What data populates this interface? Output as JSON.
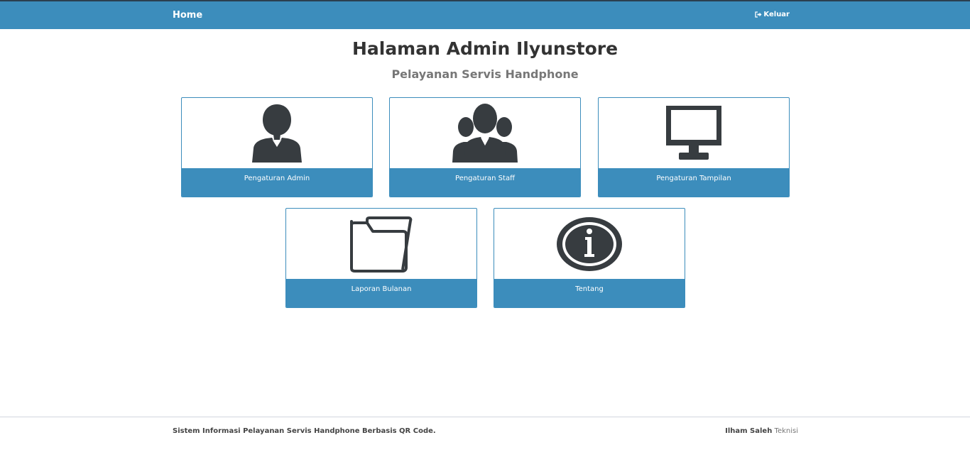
{
  "navbar": {
    "brand": "Home",
    "logout_label": "Keluar",
    "logout_icon": "sign-out-icon",
    "background": "#3c8dbc"
  },
  "header": {
    "title": "Halaman Admin Ilyunstore",
    "subtitle": "Pelayanan Servis Handphone"
  },
  "tiles": [
    {
      "label": "Pengaturan Admin",
      "icon": "user-icon"
    },
    {
      "label": "Pengaturan Staff",
      "icon": "users-group-icon"
    },
    {
      "label": "Pengaturan Tampilan",
      "icon": "monitor-icon"
    },
    {
      "label": "Laporan Bulanan",
      "icon": "folder-icon"
    },
    {
      "label": "Tentang",
      "icon": "info-icon"
    }
  ],
  "footer": {
    "left_text": "Sistem Informasi Pelayanan Servis Handphone Berbasis QR Code.",
    "author": "Ilham Saleh",
    "role": "Teknisi"
  },
  "colors": {
    "accent": "#3c8dbc",
    "icon": "#373c40"
  }
}
